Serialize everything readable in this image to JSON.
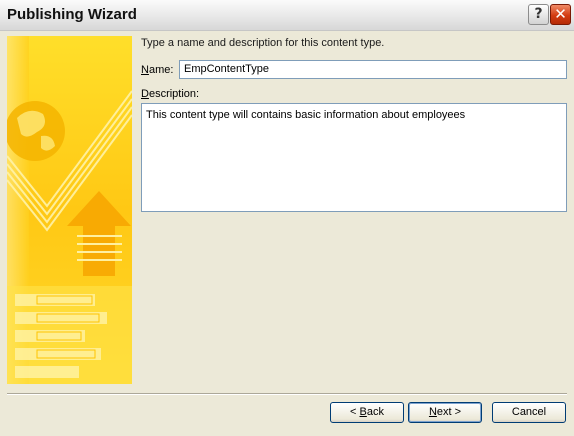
{
  "window": {
    "title": "Publishing Wizard",
    "help_glyph": "?",
    "close_glyph": "✕"
  },
  "icons": {
    "help": "help-icon",
    "close": "close-icon",
    "banner": "wizard-banner-illustration"
  },
  "colors": {
    "banner_yellow": "#ffd200",
    "button_border": "#003c74",
    "input_border": "#7f9db9"
  },
  "form": {
    "prompt": "Type a name and description for this content type.",
    "name_label_accel": "N",
    "name_label_rest": "ame:",
    "name_value": "EmpContentType",
    "description_label_accel": "D",
    "description_label_rest": "escription:",
    "description_value": "This content type will contains basic information about employees"
  },
  "buttons": {
    "back_prefix": "< ",
    "back_accel": "B",
    "back_rest": "ack",
    "next_accel": "N",
    "next_rest": "ext >",
    "cancel": "Cancel"
  }
}
